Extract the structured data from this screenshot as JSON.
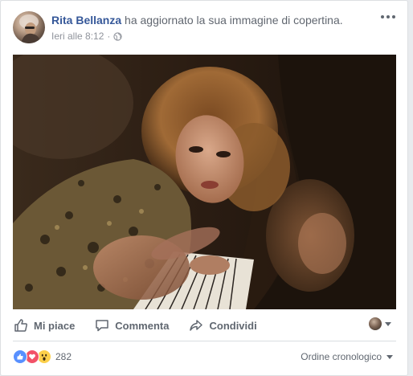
{
  "post": {
    "author": "Rita Bellanza",
    "action_text": "ha aggiornato la sua immagine di copertina.",
    "timestamp": "Ieri alle 8:12",
    "separator": "·",
    "privacy_icon": "globe-icon",
    "more_icon": "more-options-icon"
  },
  "actions": {
    "like": {
      "label": "Mi piace",
      "icon": "thumbs-up-icon"
    },
    "comment": {
      "label": "Commenta",
      "icon": "comment-icon"
    },
    "share": {
      "label": "Condividi",
      "icon": "share-icon"
    }
  },
  "reactions": {
    "icons": [
      "like-reaction-icon",
      "love-reaction-icon",
      "wow-reaction-icon"
    ],
    "count": "282"
  },
  "comments": {
    "order_label": "Ordine cronologico"
  },
  "colors": {
    "author_link": "#365899",
    "secondary_text": "#616770",
    "meta_text": "#90949c",
    "like_blue": "#5890ff",
    "love_red": "#f25268",
    "wow_yellow": "#fcd04b"
  }
}
